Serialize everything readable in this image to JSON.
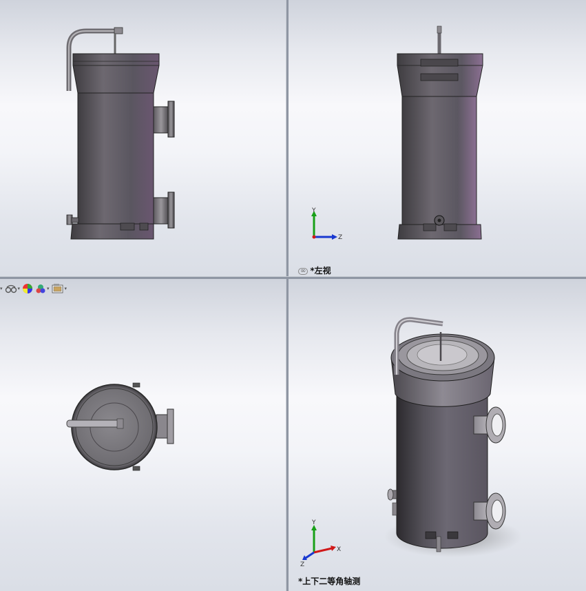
{
  "views": {
    "top_right_label": "*左视",
    "bottom_right_label": "*上下二等角轴测"
  },
  "triad": {
    "x_label": "X",
    "y_label": "Y",
    "z_label": "Z"
  },
  "hud_tools": [
    {
      "name": "display-style-icon"
    },
    {
      "name": "view-settings-icon"
    },
    {
      "name": "appearance-icon"
    },
    {
      "name": "scene-icon"
    },
    {
      "name": "view-orientation-icon"
    }
  ],
  "colors": {
    "body": "#5d5a5e",
    "body_highlight": "#8a7a8e",
    "triad_x": "#d01818",
    "triad_y": "#18a018",
    "triad_z": "#1838d0"
  }
}
